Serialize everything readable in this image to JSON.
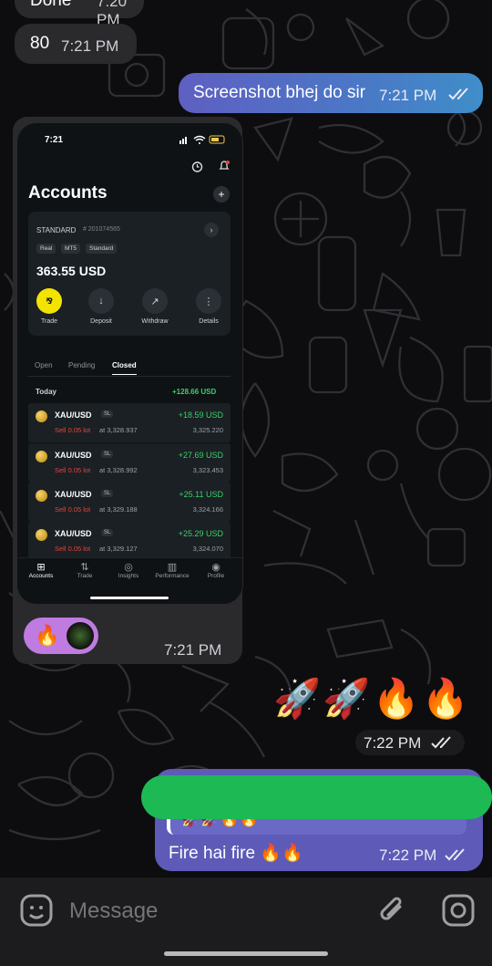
{
  "messages": {
    "m1": {
      "text": "Done",
      "time": "7:20 PM"
    },
    "m2": {
      "text": "80",
      "time": "7:21 PM"
    },
    "m3": {
      "text": "Screenshot bhej do sir",
      "time": "7:21 PM"
    },
    "m4": {
      "time": "7:21 PM",
      "reaction_emoji": "🔥"
    },
    "m5": {
      "emojis": "🚀🚀🔥🔥",
      "time": "7:22 PM"
    },
    "m6": {
      "quote_emojis": "🚀🚀🔥🔥",
      "text": "Fire hai fire 🔥🔥",
      "time": "7:22 PM"
    }
  },
  "screenshot": {
    "status_time": "7:21",
    "title": "Accounts",
    "account": {
      "type": "STANDARD",
      "number": "# 201074565",
      "tags": [
        "Real",
        "MT5",
        "Standard"
      ],
      "balance": "363.55 USD"
    },
    "actions": [
      "Trade",
      "Deposit",
      "Withdraw",
      "Details"
    ],
    "tabs": [
      "Open",
      "Pending",
      "Closed"
    ],
    "active_tab": "Closed",
    "today_label": "Today",
    "today_total": "+128.66 USD",
    "trades": [
      {
        "symbol": "XAU/USD",
        "badge": "SL",
        "side": "Sell 0.05 lot",
        "at": "at 3,328.937",
        "pnl": "+18.59 USD",
        "close": "3,325.220"
      },
      {
        "symbol": "XAU/USD",
        "badge": "SL",
        "side": "Sell 0.05 lot",
        "at": "at 3,328.992",
        "pnl": "+27.69 USD",
        "close": "3,323.453"
      },
      {
        "symbol": "XAU/USD",
        "badge": "SL",
        "side": "Sell 0.05 lot",
        "at": "at 3,329.188",
        "pnl": "+25.11 USD",
        "close": "3,324.166"
      },
      {
        "symbol": "XAU/USD",
        "badge": "SL",
        "side": "Sell 0.05 lot",
        "at": "at 3,329.127",
        "pnl": "+25.29 USD",
        "close": "3,324.070"
      }
    ],
    "nav": [
      "Accounts",
      "Trade",
      "Insights",
      "Performance",
      "Profile"
    ]
  },
  "composer": {
    "placeholder": "Message"
  },
  "colors": {
    "outgoing_bubble": "#5d5bb7",
    "incoming_bubble": "#2a2a2d",
    "positive": "#3ccf6a",
    "sell": "#e2453d",
    "redaction": "#1db954"
  }
}
